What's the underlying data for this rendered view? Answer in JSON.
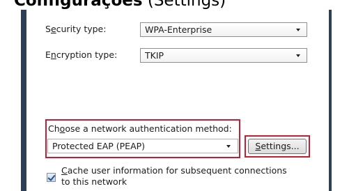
{
  "caption": {
    "bold": "Configurações",
    "normal": "(Settings)"
  },
  "security_type": {
    "label_pre": "S",
    "label_accel": "e",
    "label_post": "curity type:",
    "value": "WPA-Enterprise"
  },
  "encryption_type": {
    "label_pre": "E",
    "label_accel": "n",
    "label_post": "cryption type:",
    "value": "TKIP"
  },
  "auth_method": {
    "label_pre": "Ch",
    "label_accel": "o",
    "label_post": "ose a network authentication method:",
    "value": "Protected EAP (PEAP)",
    "settings_pre": "",
    "settings_accel": "S",
    "settings_post": "ettings..."
  },
  "cache": {
    "checked": true,
    "line1_pre": "",
    "line1_accel": "C",
    "line1_post": "ache user information for subsequent connections",
    "line2": "to this network"
  }
}
